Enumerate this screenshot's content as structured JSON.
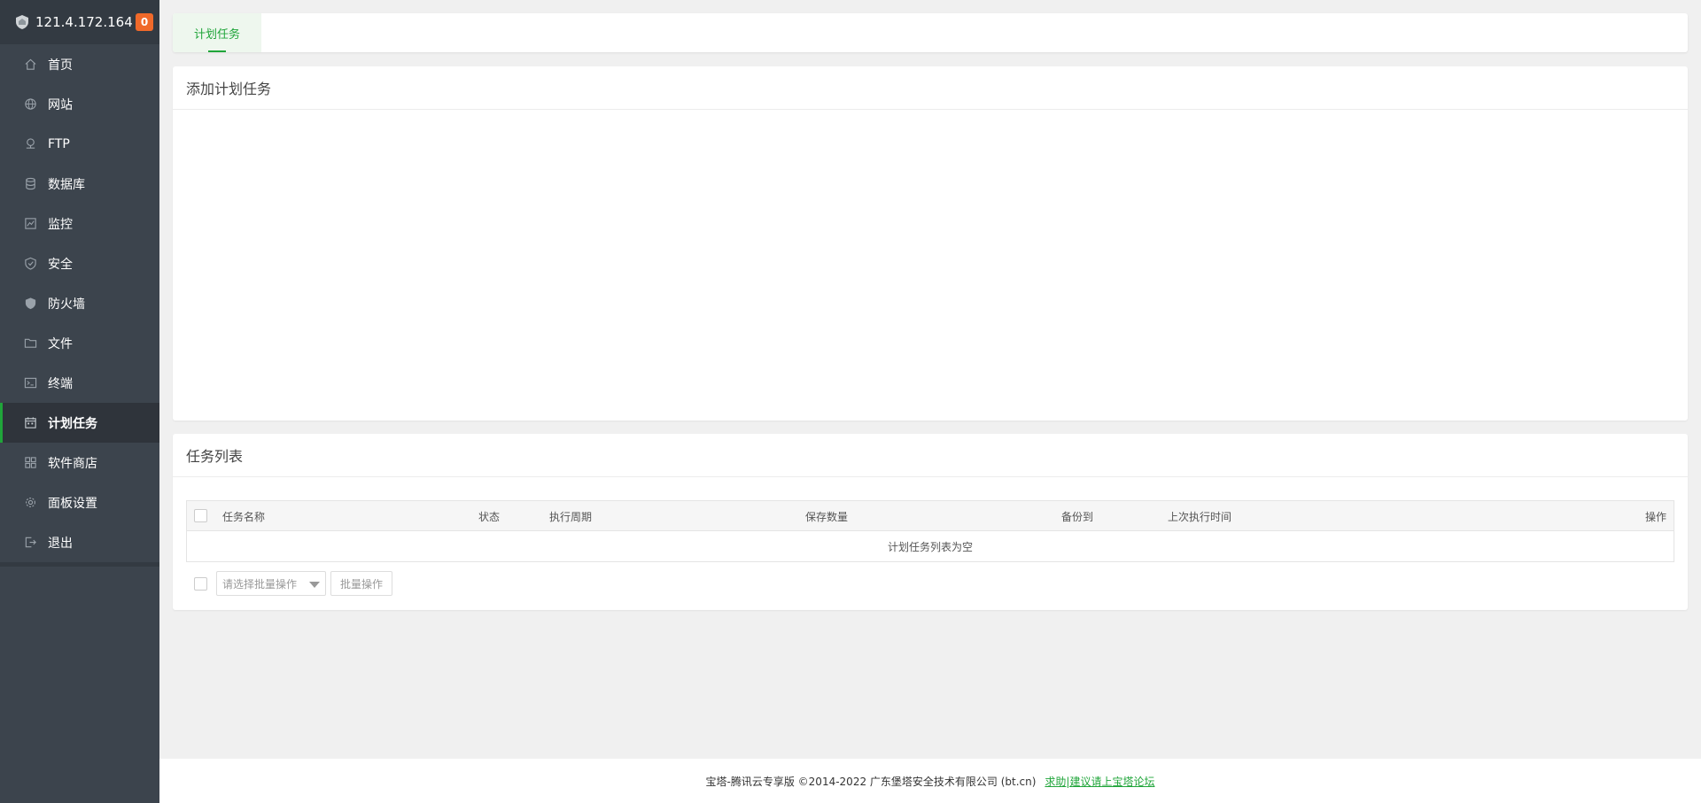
{
  "sidebar": {
    "server_ip": "121.4.172.164",
    "badge_count": "0",
    "items": [
      {
        "label": "首页",
        "icon": "home-icon"
      },
      {
        "label": "网站",
        "icon": "globe-icon"
      },
      {
        "label": "FTP",
        "icon": "ftp-icon"
      },
      {
        "label": "数据库",
        "icon": "database-icon"
      },
      {
        "label": "监控",
        "icon": "monitor-icon"
      },
      {
        "label": "安全",
        "icon": "shield-icon"
      },
      {
        "label": "防火墙",
        "icon": "firewall-icon"
      },
      {
        "label": "文件",
        "icon": "folder-icon"
      },
      {
        "label": "终端",
        "icon": "terminal-icon"
      },
      {
        "label": "计划任务",
        "icon": "calendar-icon",
        "active": true
      },
      {
        "label": "软件商店",
        "icon": "grid-icon"
      },
      {
        "label": "面板设置",
        "icon": "gear-icon"
      },
      {
        "label": "退出",
        "icon": "logout-icon"
      }
    ]
  },
  "tabs": [
    {
      "label": "计划任务",
      "active": true
    }
  ],
  "add_panel": {
    "title": "添加计划任务"
  },
  "list_panel": {
    "title": "任务列表",
    "columns": [
      "任务名称",
      "状态",
      "执行周期",
      "保存数量",
      "备份到",
      "上次执行时间",
      "操作"
    ],
    "empty_text": "计划任务列表为空",
    "batch_placeholder": "请选择批量操作",
    "batch_button": "批量操作"
  },
  "footer": {
    "copyright": "宝塔-腾讯云专享版 ©2014-2022 广东堡塔安全技术有限公司 (bt.cn)",
    "link": "求助|建议请上宝塔论坛"
  },
  "colors": {
    "accent": "#20a53a",
    "sidebar_bg": "#3c444d",
    "badge": "#f0692a"
  }
}
